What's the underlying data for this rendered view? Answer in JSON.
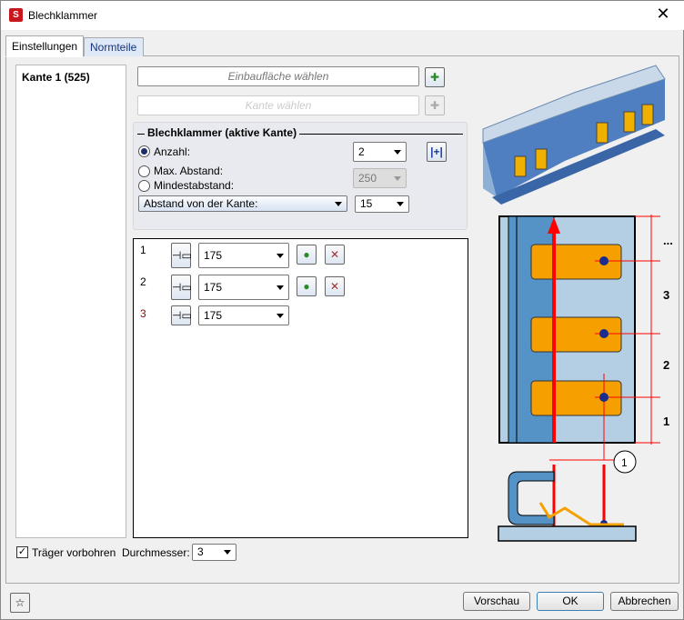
{
  "window": {
    "title": "Blechklammer",
    "close": "✕",
    "app_icon": "S"
  },
  "tabs": [
    {
      "label": "Einstellungen",
      "active": true
    },
    {
      "label": "Normteile",
      "active": false
    }
  ],
  "edges": [
    {
      "label": "Kante 1 (525)"
    }
  ],
  "select_surface": {
    "placeholder": "Einbaufläche wählen"
  },
  "select_edge": {
    "placeholder": "Kante wählen"
  },
  "group": {
    "title": "Blechklammer (aktive Kante)",
    "anzahl_label": "Anzahl:",
    "anzahl_value": "2",
    "anzahl_selected": true,
    "max_label": "Max. Abstand:",
    "min_label": "Mindestabstand:",
    "abstand_value": "250",
    "mode_value": "Abstand von der Kante:",
    "mode_number": "15"
  },
  "rows": [
    {
      "index": "1",
      "value": "175",
      "has_actions": true
    },
    {
      "index": "2",
      "value": "175",
      "has_actions": true
    },
    {
      "index": "3",
      "value": "175",
      "has_actions": false
    }
  ],
  "diagram": {
    "labels": [
      "...",
      "3",
      "2",
      "1"
    ],
    "circle": "1"
  },
  "bottom": {
    "vorbohren_label": "Träger vorbohren",
    "vorbohren_checked": true,
    "durchmesser_label": "Durchmesser:",
    "durchmesser_value": "3"
  },
  "buttons": {
    "preview": "Vorschau",
    "ok": "OK",
    "cancel": "Abbrechen"
  },
  "colors": {
    "orange": "#f5a000",
    "blue": "#5592c6",
    "light_blue": "#b4cfe4",
    "red": "#ff0000"
  }
}
